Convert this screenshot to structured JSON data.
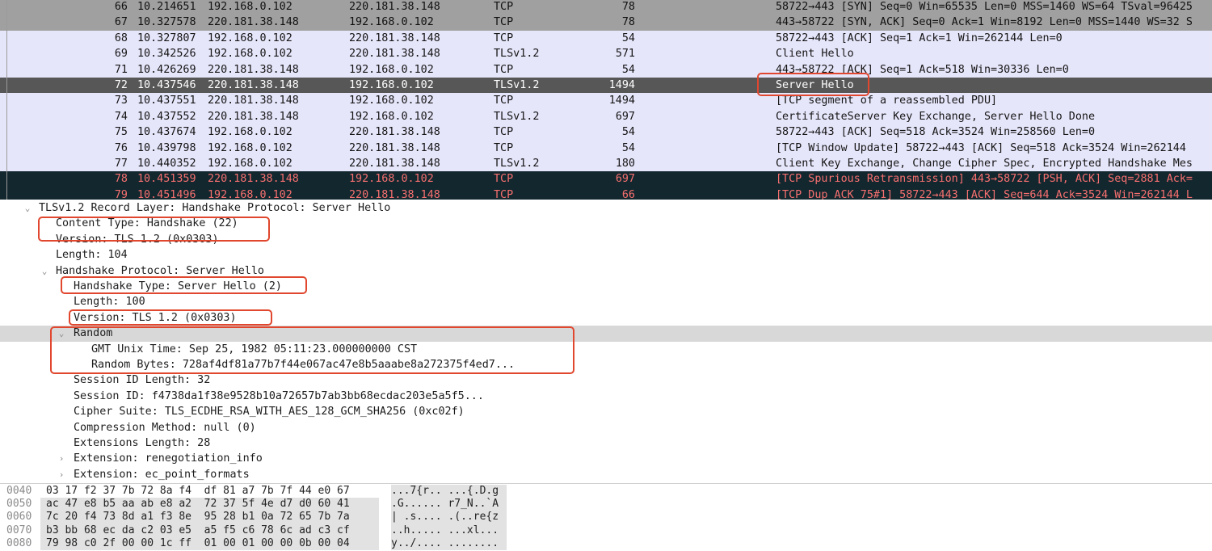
{
  "colors": {
    "syn_row": "#a0a0a0",
    "normal_row": "#e6e6fb",
    "selected_row": "#575757",
    "bad_row": "#12272e",
    "bad_text": "#f77070",
    "annotation": "#e0472e",
    "highlight_row": "#d8d8d8"
  },
  "packets": [
    {
      "no": "66",
      "time": "10.214651",
      "src": "192.168.0.102",
      "dst": "220.181.38.148",
      "proto": "TCP",
      "len": "78",
      "info": "58722→443 [SYN] Seq=0 Win=65535 Len=0 MSS=1460 WS=64 TSval=96425",
      "style": "syn"
    },
    {
      "no": "67",
      "time": "10.327578",
      "src": "220.181.38.148",
      "dst": "192.168.0.102",
      "proto": "TCP",
      "len": "78",
      "info": "443→58722 [SYN, ACK] Seq=0 Ack=1 Win=8192 Len=0 MSS=1440 WS=32 S",
      "style": "syn"
    },
    {
      "no": "68",
      "time": "10.327807",
      "src": "192.168.0.102",
      "dst": "220.181.38.148",
      "proto": "TCP",
      "len": "54",
      "info": "58722→443 [ACK] Seq=1 Ack=1 Win=262144 Len=0",
      "style": "norm"
    },
    {
      "no": "69",
      "time": "10.342526",
      "src": "192.168.0.102",
      "dst": "220.181.38.148",
      "proto": "TLSv1.2",
      "len": "571",
      "info": "Client Hello",
      "style": "norm"
    },
    {
      "no": "71",
      "time": "10.426269",
      "src": "220.181.38.148",
      "dst": "192.168.0.102",
      "proto": "TCP",
      "len": "54",
      "info": "443→58722 [ACK] Seq=1 Ack=518 Win=30336 Len=0",
      "style": "norm"
    },
    {
      "no": "72",
      "time": "10.437546",
      "src": "220.181.38.148",
      "dst": "192.168.0.102",
      "proto": "TLSv1.2",
      "len": "1494",
      "info": "Server Hello",
      "style": "sel"
    },
    {
      "no": "73",
      "time": "10.437551",
      "src": "220.181.38.148",
      "dst": "192.168.0.102",
      "proto": "TCP",
      "len": "1494",
      "info": "[TCP segment of a reassembled PDU]",
      "style": "norm"
    },
    {
      "no": "74",
      "time": "10.437552",
      "src": "220.181.38.148",
      "dst": "192.168.0.102",
      "proto": "TLSv1.2",
      "len": "697",
      "info": "CertificateServer Key Exchange, Server Hello Done",
      "style": "norm"
    },
    {
      "no": "75",
      "time": "10.437674",
      "src": "192.168.0.102",
      "dst": "220.181.38.148",
      "proto": "TCP",
      "len": "54",
      "info": "58722→443 [ACK] Seq=518 Ack=3524 Win=258560 Len=0",
      "style": "norm"
    },
    {
      "no": "76",
      "time": "10.439798",
      "src": "192.168.0.102",
      "dst": "220.181.38.148",
      "proto": "TCP",
      "len": "54",
      "info": "[TCP Window Update] 58722→443 [ACK] Seq=518 Ack=3524 Win=262144",
      "style": "norm"
    },
    {
      "no": "77",
      "time": "10.440352",
      "src": "192.168.0.102",
      "dst": "220.181.38.148",
      "proto": "TLSv1.2",
      "len": "180",
      "info": "Client Key Exchange, Change Cipher Spec, Encrypted Handshake Mes",
      "style": "norm"
    },
    {
      "no": "78",
      "time": "10.451359",
      "src": "220.181.38.148",
      "dst": "192.168.0.102",
      "proto": "TCP",
      "len": "697",
      "info": "[TCP Spurious Retransmission] 443→58722 [PSH, ACK] Seq=2881 Ack=",
      "style": "bad"
    },
    {
      "no": "79",
      "time": "10.451496",
      "src": "192.168.0.102",
      "dst": "220.181.38.148",
      "proto": "TCP",
      "len": "66",
      "info": "[TCP Dup ACK 75#1] 58722→443 [ACK] Seq=644 Ack=3524 Win=262144 L",
      "style": "bad"
    }
  ],
  "details": [
    {
      "text": "TLSv1.2 Record Layer: Handshake Protocol: Server Hello",
      "level": 0,
      "toggle": "expanded"
    },
    {
      "text": "Content Type: Handshake (22)",
      "level": 1,
      "toggle": ""
    },
    {
      "text": "Version: TLS 1.2 (0x0303)",
      "level": 1,
      "toggle": ""
    },
    {
      "text": "Length: 104",
      "level": 1,
      "toggle": ""
    },
    {
      "text": "Handshake Protocol: Server Hello",
      "level": 1,
      "toggle": "expanded"
    },
    {
      "text": "Handshake Type: Server Hello (2)",
      "level": 2,
      "toggle": ""
    },
    {
      "text": "Length: 100",
      "level": 2,
      "toggle": ""
    },
    {
      "text": "Version: TLS 1.2 (0x0303)",
      "level": 2,
      "toggle": ""
    },
    {
      "text": "Random",
      "level": 2,
      "toggle": "expanded",
      "highlight": true
    },
    {
      "text": "GMT Unix Time: Sep 25, 1982 05:11:23.000000000 CST",
      "level": 3,
      "toggle": ""
    },
    {
      "text": "Random Bytes: 728af4df81a77b7f44e067ac47e8b5aaabe8a272375f4ed7...",
      "level": 3,
      "toggle": ""
    },
    {
      "text": "Session ID Length: 32",
      "level": 2,
      "toggle": ""
    },
    {
      "text": "Session ID: f4738da1f38e9528b10a72657b7ab3bb68ecdac203e5a5f5...",
      "level": 2,
      "toggle": ""
    },
    {
      "text": "Cipher Suite: TLS_ECDHE_RSA_WITH_AES_128_GCM_SHA256 (0xc02f)",
      "level": 2,
      "toggle": ""
    },
    {
      "text": "Compression Method: null (0)",
      "level": 2,
      "toggle": ""
    },
    {
      "text": "Extensions Length: 28",
      "level": 2,
      "toggle": ""
    },
    {
      "text": "Extension: renegotiation_info",
      "level": 2,
      "toggle": "collapsed"
    },
    {
      "text": "Extension: ec_point_formats",
      "level": 2,
      "toggle": "collapsed"
    }
  ],
  "bytes": [
    {
      "offset": "0040",
      "hex": "03 17 f2 37 7b 72 8a f4  df 81 a7 7b 7f 44 e0 67",
      "ascii": "...7{r.. ...{.D.g",
      "shade": "part"
    },
    {
      "offset": "0050",
      "hex": "ac 47 e8 b5 aa ab e8 a2  72 37 5f 4e d7 d0 60 41",
      "ascii": ".G...... r7_N..`A",
      "shade": "full"
    },
    {
      "offset": "0060",
      "hex": "7c 20 f4 73 8d a1 f3 8e  95 28 b1 0a 72 65 7b 7a",
      "ascii": "| .s.... .(..re{z",
      "shade": "full"
    },
    {
      "offset": "0070",
      "hex": "b3 bb 68 ec da c2 03 e5  a5 f5 c6 78 6c ad c3 cf",
      "ascii": "..h..... ...xl...",
      "shade": "full"
    },
    {
      "offset": "0080",
      "hex": "79 98 c0 2f 00 00 1c ff  01 00 01 00 00 0b 00 04",
      "ascii": "y../.... ........",
      "shade": "full"
    }
  ]
}
